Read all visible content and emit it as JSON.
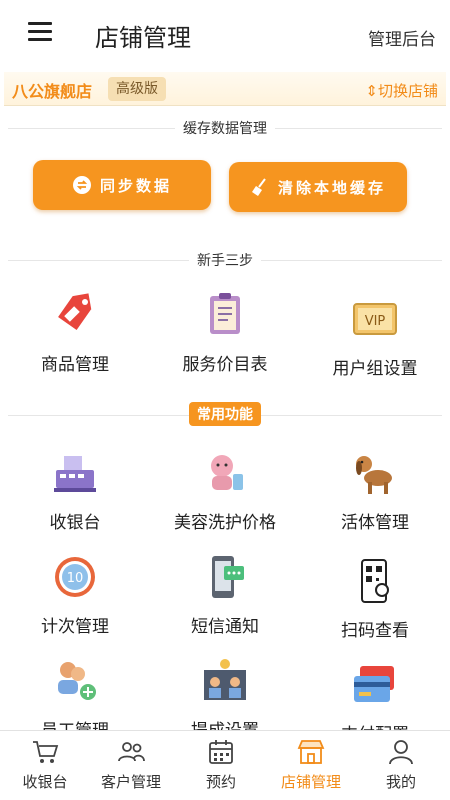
{
  "header": {
    "title": "店铺管理",
    "admin_label": "管理后台"
  },
  "shop": {
    "name": "八公旗舰店",
    "level": "高级版",
    "switch_label": "⇕切换店铺"
  },
  "cache": {
    "section_title": "缓存数据管理",
    "sync_label": "同步数据",
    "clear_label": "清除本地缓存"
  },
  "newbie": {
    "section_title": "新手三步",
    "items": [
      {
        "label": "商品管理",
        "icon": "price-tag-icon"
      },
      {
        "label": "服务价目表",
        "icon": "clipboard-icon"
      },
      {
        "label": "用户组设置",
        "icon": "vip-card-icon"
      }
    ]
  },
  "common": {
    "section_title": "常用功能",
    "items": [
      {
        "label": "收银台",
        "icon": "cash-register-icon"
      },
      {
        "label": "美容洗护价格",
        "icon": "grooming-dog-icon"
      },
      {
        "label": "活体管理",
        "icon": "dog-icon"
      },
      {
        "label": "计次管理",
        "icon": "counter-icon"
      },
      {
        "label": "短信通知",
        "icon": "sms-phone-icon"
      },
      {
        "label": "扫码查看",
        "icon": "qr-scan-icon"
      },
      {
        "label": "员工管理",
        "icon": "staff-icon"
      },
      {
        "label": "提成设置",
        "icon": "commission-icon"
      },
      {
        "label": "支付配置",
        "icon": "payment-card-icon"
      }
    ]
  },
  "tabbar": [
    {
      "label": "收银台",
      "icon": "cart-icon"
    },
    {
      "label": "客户管理",
      "icon": "customers-icon"
    },
    {
      "label": "预约",
      "icon": "calendar-icon"
    },
    {
      "label": "店铺管理",
      "icon": "store-icon",
      "active": true
    },
    {
      "label": "我的",
      "icon": "profile-icon"
    }
  ],
  "colors": {
    "accent": "#f6951f",
    "accent_text": "#f28c1a",
    "level_badge": "#f6dfb3"
  }
}
